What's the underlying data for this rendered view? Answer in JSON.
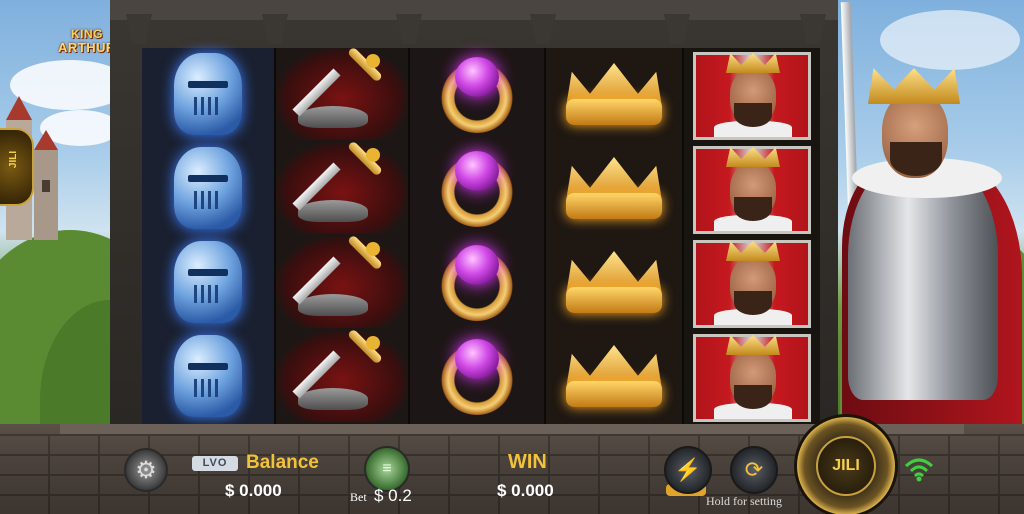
{
  "game": {
    "logo_line1": "KING",
    "logo_line2": "ARTHUR",
    "side_tab": "JILI"
  },
  "reels": [
    {
      "symbol": "blue-knight-helmet",
      "rows": 4
    },
    {
      "symbol": "sword-in-stone",
      "rows": 4
    },
    {
      "symbol": "purple-gem-ring",
      "rows": 4
    },
    {
      "symbol": "golden-crown",
      "rows": 4
    },
    {
      "symbol": "king-arthur-portrait",
      "rows": 4
    }
  ],
  "controls": {
    "settings_icon": "gear-icon",
    "level_badge": "LVO",
    "balance_label": "Balance",
    "balance_value": "$ 0.000",
    "bet_label": "Bet",
    "bet_value": "$ 0.2",
    "win_label": "WIN",
    "win_value": "$ 0.000",
    "turbo_icon": "lightning-icon",
    "autospin_icon": "autospin-icon",
    "hold_hint": "Hold for setting",
    "spin_label": "JILI"
  },
  "colors": {
    "gold_text": "#f2c23b",
    "white_text": "#ffffff",
    "wifi_green": "#3fcf3f"
  }
}
